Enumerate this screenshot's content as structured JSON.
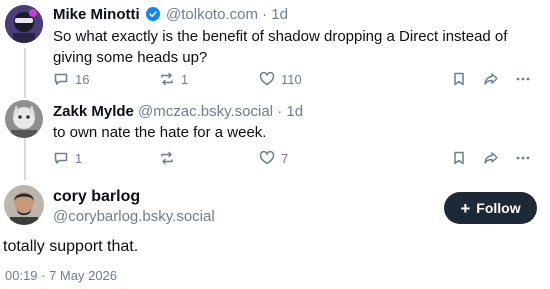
{
  "replies": [
    {
      "name": "Mike Minotti",
      "handle": "@tolkoto.com",
      "sep": "·",
      "time": "1d",
      "text": "So what exactly is the benefit of shadow dropping a Direct instead of giving some heads up?",
      "replies": "16",
      "reposts": "1",
      "likes": "110",
      "verified": true
    },
    {
      "name": "Zakk Mylde",
      "handle": "@mczac.bsky.social",
      "sep": "·",
      "time": "1d",
      "text": "to own nate the hate for a week.",
      "replies": "1",
      "reposts": "",
      "likes": "7"
    }
  ],
  "main": {
    "name": "cory barlog",
    "handle": "@corybarlog.bsky.social",
    "follow_label": "Follow",
    "text": "totally support that.",
    "timestamp": "00:19 · 7 May 2026"
  },
  "colors": {
    "accent": "#1185fe",
    "muted": "#6f7d8c",
    "follow_bg": "#1e2937"
  }
}
